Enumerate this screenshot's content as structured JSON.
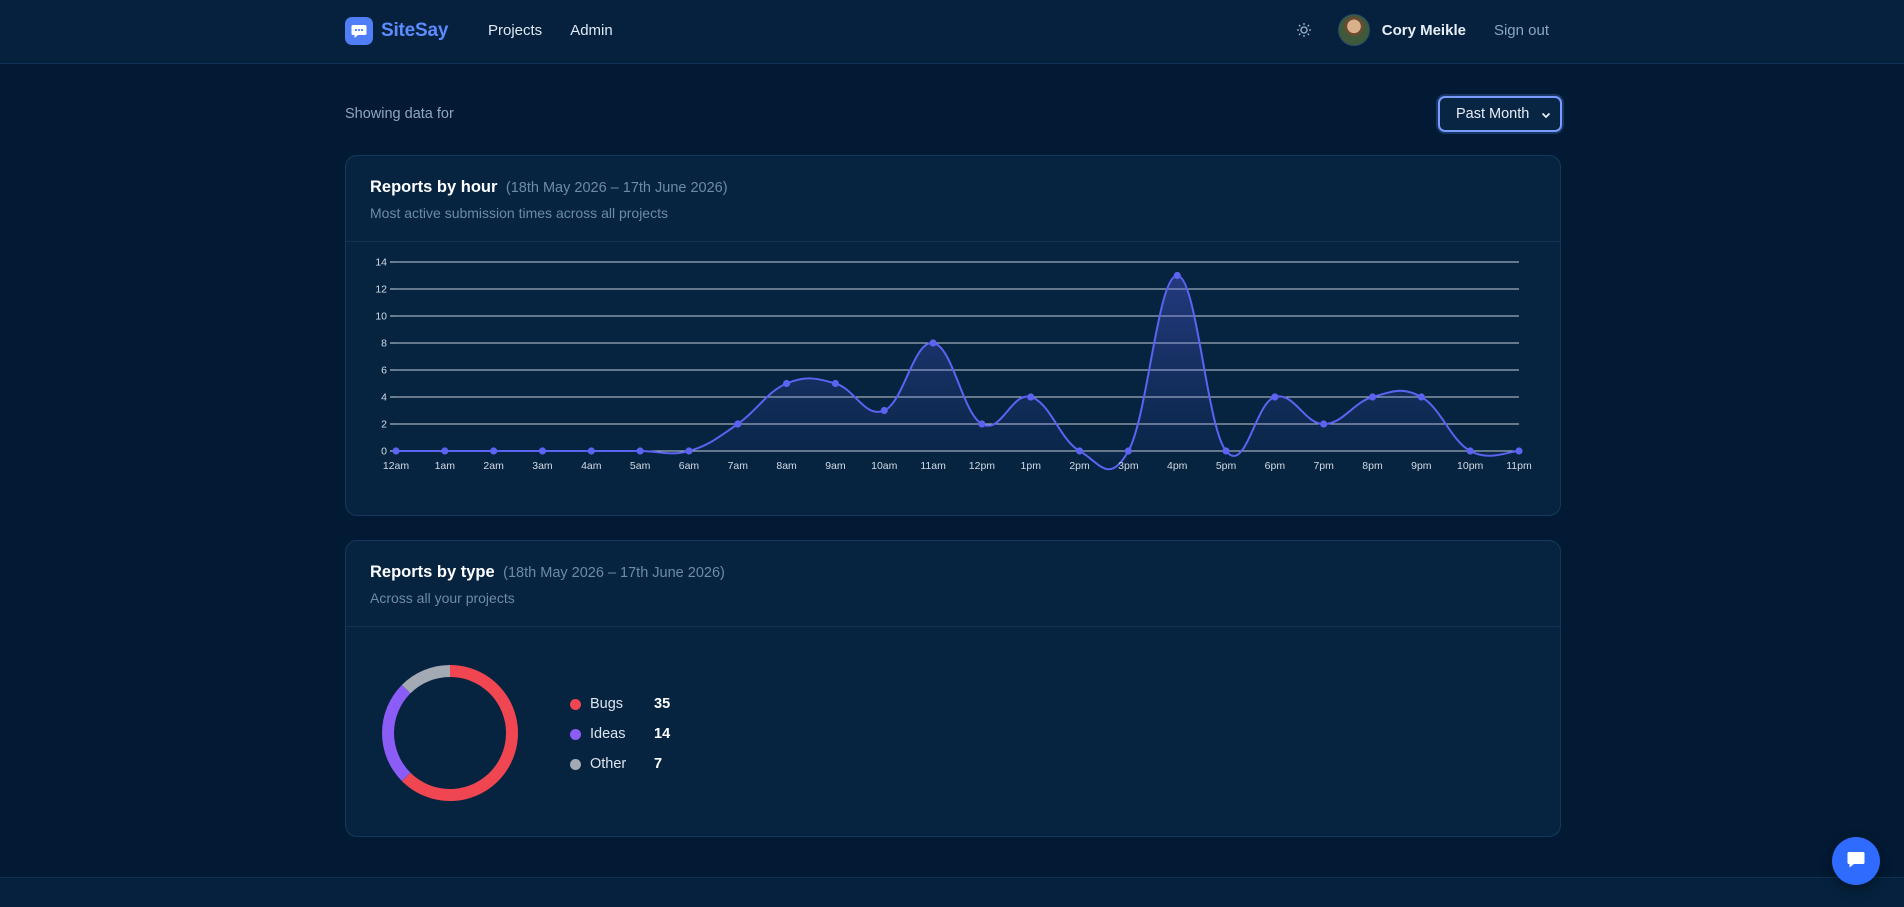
{
  "brand": {
    "name": "SiteSay",
    "logo_icon": "chat-bubble-icon",
    "accent": "#5b8cff"
  },
  "nav": {
    "items": [
      {
        "label": "Projects"
      },
      {
        "label": "Admin"
      }
    ]
  },
  "user": {
    "theme_icon": "sun-icon",
    "name": "Cory Meikle",
    "signout": "Sign out"
  },
  "filter": {
    "label": "Showing data for",
    "selected": "Past Month"
  },
  "hour_card": {
    "title": "Reports by hour",
    "range": "(18th May 2026 – 17th June 2026)",
    "subtitle": "Most active submission times across all projects"
  },
  "type_card": {
    "title": "Reports by type",
    "range": "(18th May 2026 – 17th June 2026)",
    "subtitle": "Across all your projects",
    "legend": [
      {
        "label": "Bugs",
        "value": "35",
        "color": "#ef4651"
      },
      {
        "label": "Ideas",
        "value": "14",
        "color": "#8b5cf6"
      },
      {
        "label": "Other",
        "value": "7",
        "color": "#a3aab4"
      }
    ]
  },
  "chart_data": [
    {
      "type": "area",
      "categories": [
        "12am",
        "1am",
        "2am",
        "3am",
        "4am",
        "5am",
        "6am",
        "7am",
        "8am",
        "9am",
        "10am",
        "11am",
        "12pm",
        "1pm",
        "2pm",
        "3pm",
        "4pm",
        "5pm",
        "6pm",
        "7pm",
        "8pm",
        "9pm",
        "10pm",
        "11pm"
      ],
      "values": [
        0,
        0,
        0,
        0,
        0,
        0,
        0,
        2,
        5,
        5,
        3,
        8,
        2,
        4,
        0,
        0,
        13,
        0,
        4,
        2,
        4,
        4,
        0,
        0
      ],
      "yticks": [
        0,
        2,
        4,
        6,
        8,
        10,
        12,
        14
      ],
      "ylim": [
        0,
        14
      ],
      "grid": true,
      "line_color": "#5b63f0"
    },
    {
      "type": "pie",
      "categories": [
        "Bugs",
        "Ideas",
        "Other"
      ],
      "values": [
        35,
        14,
        7
      ],
      "colors": [
        "#ef4651",
        "#8b5cf6",
        "#a3aab4"
      ]
    }
  ],
  "chat_button": {
    "icon": "chat-icon"
  }
}
